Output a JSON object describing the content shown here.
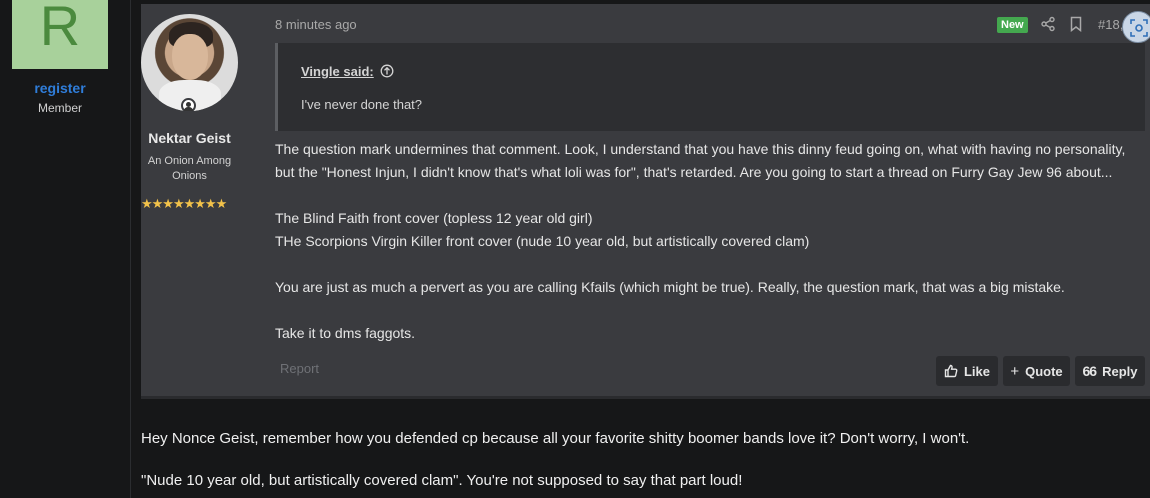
{
  "outer_user": {
    "avatar_letter": "R",
    "username": "register",
    "role": "Member"
  },
  "post": {
    "author": "Nektar Geist",
    "author_title": "An Onion Among Onions",
    "stars": "★★★★★★★★",
    "time": "8 minutes ago",
    "new_badge": "New",
    "post_number": "#18,",
    "quote": {
      "author": "Vingle said:",
      "text": "I've never done that?"
    },
    "body": [
      "The question mark undermines that comment. Look, I understand that you have this dinny feud going on, what with having no personality, but the \"Honest Injun, I didn't know that's what loli was for\", that's retarded. Are you going to start a thread on Furry Gay Jew 96 about...",
      "",
      "The Blind Faith front cover (topless 12 year old girl)",
      "THe Scorpions Virgin Killer front cover (nude 10 year old, but artistically covered clam)",
      "",
      "You are just as much a pervert as you are calling Kfails (which might be true). Really, the question mark, that was a big mistake.",
      "",
      "Take it to dms faggots."
    ],
    "report_label": "Report",
    "like_label": "Like",
    "quote_label": "Quote",
    "reply_label": "Reply"
  },
  "reply": {
    "paragraphs": [
      "Hey Nonce Geist, remember how you defended cp because all your favorite shitty boomer bands love it? Don't worry, I won't.",
      "\"Nude 10 year old, but artistically covered clam\". You're not supposed to say that part loud!"
    ]
  },
  "colors": {
    "background": "#161718",
    "post_bg": "#3a3b3f",
    "quote_bg": "#2d2e31",
    "username_blue": "#2f7dd9",
    "new_badge_green": "#44a84f",
    "star_gold": "#f2c24a"
  }
}
